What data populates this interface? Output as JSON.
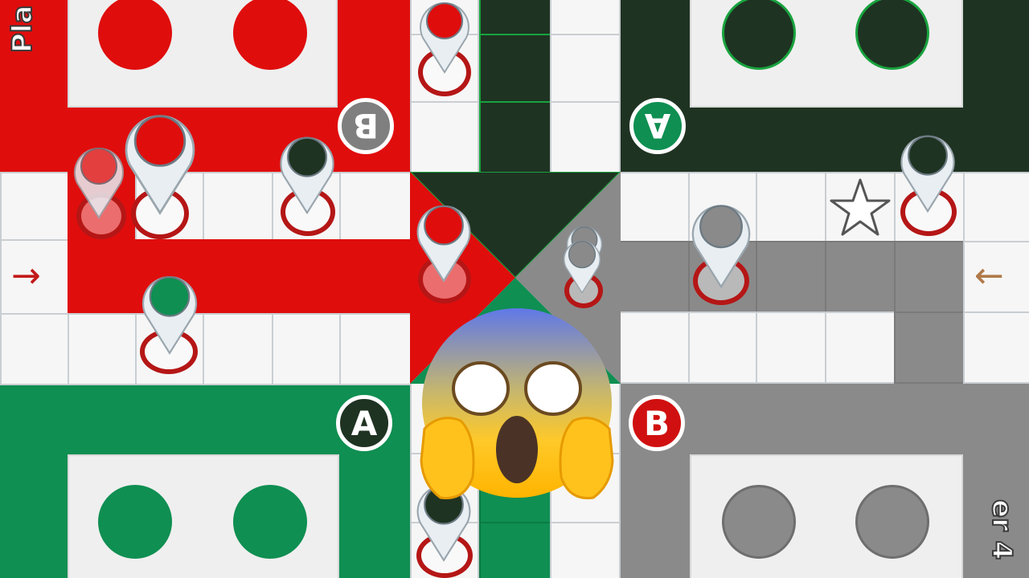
{
  "players": {
    "top_left_label": "Pla",
    "bottom_right_label": "er 4"
  },
  "markers": {
    "top_left": "B",
    "top_right": "A",
    "bottom_left": "A",
    "bottom_right": "B"
  },
  "arrows": {
    "left": "→",
    "right": "←"
  },
  "icons": {
    "star": "star-icon",
    "reaction": "shocked-face-emoji"
  },
  "colors": {
    "red": "#e00d0d",
    "dark_green": "#1f3322",
    "green": "#0f8f52",
    "grey": "#8a8a8a",
    "pin_white": "#e8eef2"
  }
}
